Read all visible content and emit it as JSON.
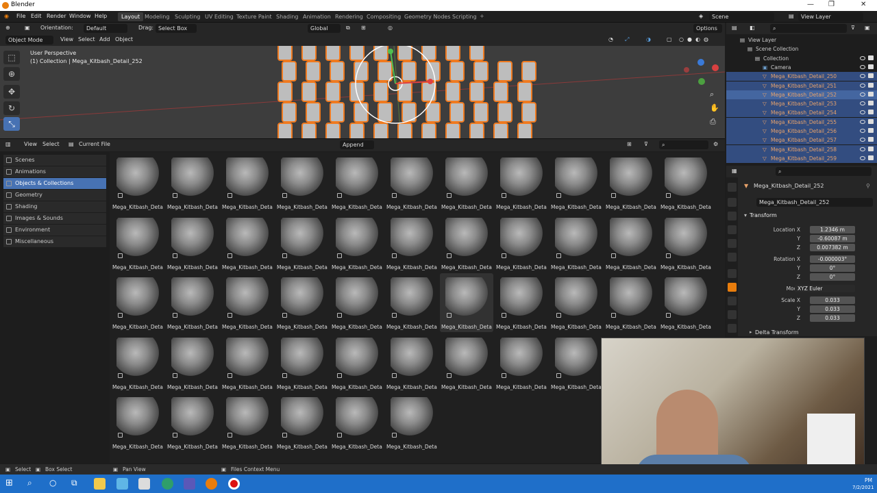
{
  "window": {
    "title": "Blender"
  },
  "menu": {
    "file": "File",
    "edit": "Edit",
    "render": "Render",
    "window": "Window",
    "help": "Help"
  },
  "workspaces": [
    "Layout",
    "Modeling",
    "Sculpting",
    "UV Editing",
    "Texture Paint",
    "Shading",
    "Animation",
    "Rendering",
    "Compositing",
    "Geometry Nodes",
    "Scripting"
  ],
  "scene": {
    "name": "Scene",
    "view_layer": "View Layer"
  },
  "viewport_header": {
    "orientation_label": "Orientation:",
    "orientation_value": "Default",
    "drag_label": "Drag:",
    "drag_value": "Select Box",
    "transform_value": "Global",
    "options": "Options"
  },
  "viewport_header2": {
    "mode": "Object Mode",
    "view": "View",
    "select": "Select",
    "add": "Add",
    "object": "Object"
  },
  "viewport": {
    "perspective": "User Perspective",
    "collection_info": "(1) Collection | Mega_Kitbash_Detail_252"
  },
  "file_browser": {
    "view": "View",
    "select": "Select",
    "source": "Current File",
    "append": "Append"
  },
  "categories": [
    {
      "label": "Scenes",
      "active": false
    },
    {
      "label": "Animations",
      "active": false
    },
    {
      "label": "Objects & Collections",
      "active": true
    },
    {
      "label": "Geometry",
      "active": false
    },
    {
      "label": "Shading",
      "active": false
    },
    {
      "label": "Images & Sounds",
      "active": false
    },
    {
      "label": "Environment",
      "active": false
    },
    {
      "label": "Miscellaneous",
      "active": false
    }
  ],
  "asset_label": "Mega_Kitbash_Detai...",
  "asset_rows": [
    11,
    11,
    11,
    9,
    6
  ],
  "selected_asset": {
    "row": 2,
    "col": 6
  },
  "outliner": {
    "rows": [
      {
        "name": "View Layer",
        "indent": 0,
        "type": "layer"
      },
      {
        "name": "Scene Collection",
        "indent": 1,
        "type": "coll"
      },
      {
        "name": "Collection",
        "indent": 2,
        "type": "coll"
      },
      {
        "name": "Camera",
        "indent": 3,
        "type": "cam"
      },
      {
        "name": "Mega_Kitbash_Detail_250",
        "indent": 3,
        "type": "obj"
      },
      {
        "name": "Mega_Kitbash_Detail_251",
        "indent": 3,
        "type": "obj"
      },
      {
        "name": "Mega_Kitbash_Detail_252",
        "indent": 3,
        "type": "obj",
        "active": true
      },
      {
        "name": "Mega_Kitbash_Detail_253",
        "indent": 3,
        "type": "obj"
      },
      {
        "name": "Mega_Kitbash_Detail_254",
        "indent": 3,
        "type": "obj"
      },
      {
        "name": "Mega_Kitbash_Detail_255",
        "indent": 3,
        "type": "obj"
      },
      {
        "name": "Mega_Kitbash_Detail_256",
        "indent": 3,
        "type": "obj"
      },
      {
        "name": "Mega_Kitbash_Detail_257",
        "indent": 3,
        "type": "obj"
      },
      {
        "name": "Mega_Kitbash_Detail_258",
        "indent": 3,
        "type": "obj"
      },
      {
        "name": "Mega_Kitbash_Detail_259",
        "indent": 3,
        "type": "obj"
      }
    ]
  },
  "properties": {
    "object_name": "Mega_Kitbash_Detail_252",
    "object_field": "Mega_Kitbash_Detail_252",
    "transform_header": "Transform",
    "location_label": "Location X",
    "loc_x": "1.2346 m",
    "loc_y": "-0.60087 m",
    "loc_z": "0.007382 m",
    "rotation_label": "Rotation X",
    "rot_x": "-0.000003°",
    "rot_y": "0°",
    "rot_z": "0°",
    "mode_label": "Mode",
    "mode_value": "XYZ Euler",
    "scale_label": "Scale X",
    "scale_x": "0.033",
    "scale_y": "0.033",
    "scale_z": "0.033",
    "y_label": "Y",
    "z_label": "Z",
    "delta_transform": "Delta Transform"
  },
  "status": {
    "select": "Select",
    "box_select": "Box Select",
    "pan_view": "Pan View",
    "context_menu": "Files Context Menu"
  },
  "taskbar": {
    "time": "PM",
    "date": "7/2/2021"
  }
}
